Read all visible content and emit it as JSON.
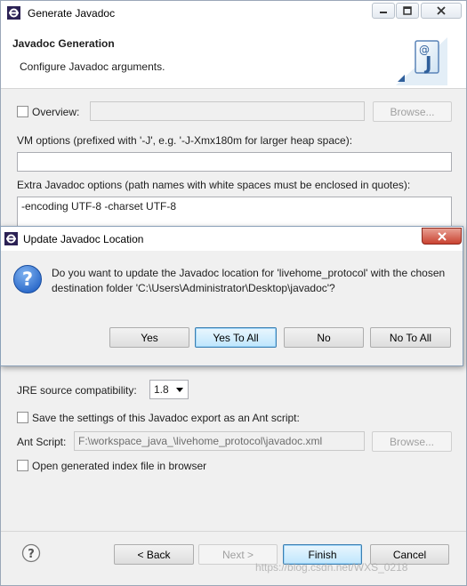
{
  "window": {
    "title": "Generate Javadoc",
    "header_title": "Javadoc Generation",
    "header_desc": "Configure Javadoc arguments."
  },
  "overview": {
    "label": "Overview:",
    "value": "",
    "browse_label": "Browse..."
  },
  "vm_options": {
    "label": "VM options (prefixed with '-J', e.g. '-J-Xmx180m for larger heap space):",
    "value": ""
  },
  "extra_options": {
    "label": "Extra Javadoc options (path names with white spaces must be enclosed in quotes):",
    "value": "-encoding UTF-8 -charset UTF-8"
  },
  "jre": {
    "label": "JRE source compatibility:",
    "value": "1.8"
  },
  "ant": {
    "save_label": "Save the settings of this Javadoc export as an Ant script:",
    "script_label": "Ant Script:",
    "script_value": "F:\\workspace_java_\\livehome_protocol\\javadoc.xml",
    "browse_label": "Browse..."
  },
  "open_index_label": "Open generated index file in browser",
  "buttons": {
    "back": "< Back",
    "next": "Next >",
    "finish": "Finish",
    "cancel": "Cancel"
  },
  "watermark": "https://blog.csdn.net/WXS_0218",
  "dialog": {
    "title": "Update Javadoc Location",
    "message": "Do you want to update the Javadoc location for 'livehome_protocol' with the chosen destination folder 'C:\\Users\\Administrator\\Desktop\\javadoc'?",
    "yes": "Yes",
    "yes_to_all": "Yes To All",
    "no": "No",
    "no_to_all": "No To All"
  },
  "icons": {
    "window": "eclipse-icon",
    "header": "javadoc-icon",
    "help": "help-icon",
    "question": "question-icon",
    "close": "close-icon"
  }
}
